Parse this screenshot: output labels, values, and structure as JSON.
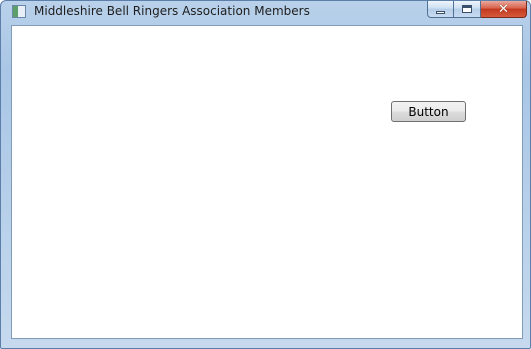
{
  "window": {
    "title": "Middleshire Bell Ringers Association Members",
    "icon": "app-window-icon",
    "caption_buttons": {
      "minimize_icon": "minimize-icon",
      "maximize_icon": "maximize-icon",
      "close_icon": "close-icon",
      "close_glyph": "✕"
    }
  },
  "content": {
    "button_label": "Button"
  },
  "colors": {
    "frame": "#b9d1ea",
    "close_button": "#c3381d",
    "client_background": "#ffffff"
  }
}
